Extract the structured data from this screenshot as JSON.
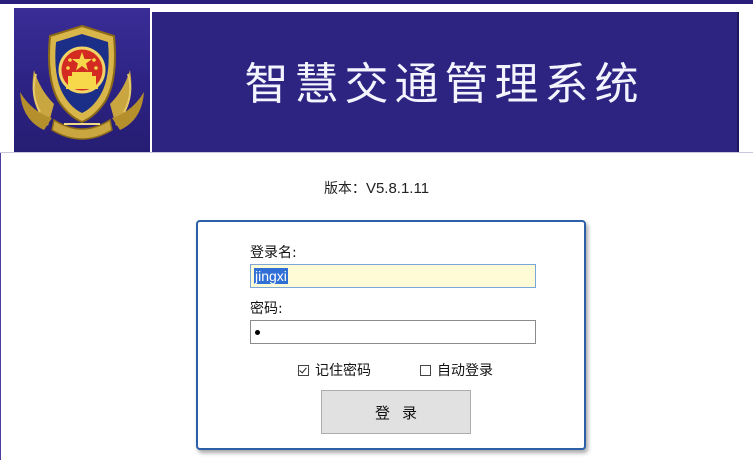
{
  "header": {
    "title": "智慧交通管理系统",
    "emblem": "police-emblem-icon"
  },
  "version": {
    "label": "版本：",
    "value": "V5.8.1.11"
  },
  "login": {
    "username_label": "登录名:",
    "username_value": "jingxi",
    "password_label": "密码:",
    "password_value": "•",
    "remember_label": "记住密码",
    "remember_checked": true,
    "autologin_label": "自动登录",
    "autologin_checked": false,
    "submit_label": "登录"
  },
  "colors": {
    "banner": "#2d2381",
    "card_border": "#2b5fa8",
    "input_highlight": "#fffbd6"
  }
}
